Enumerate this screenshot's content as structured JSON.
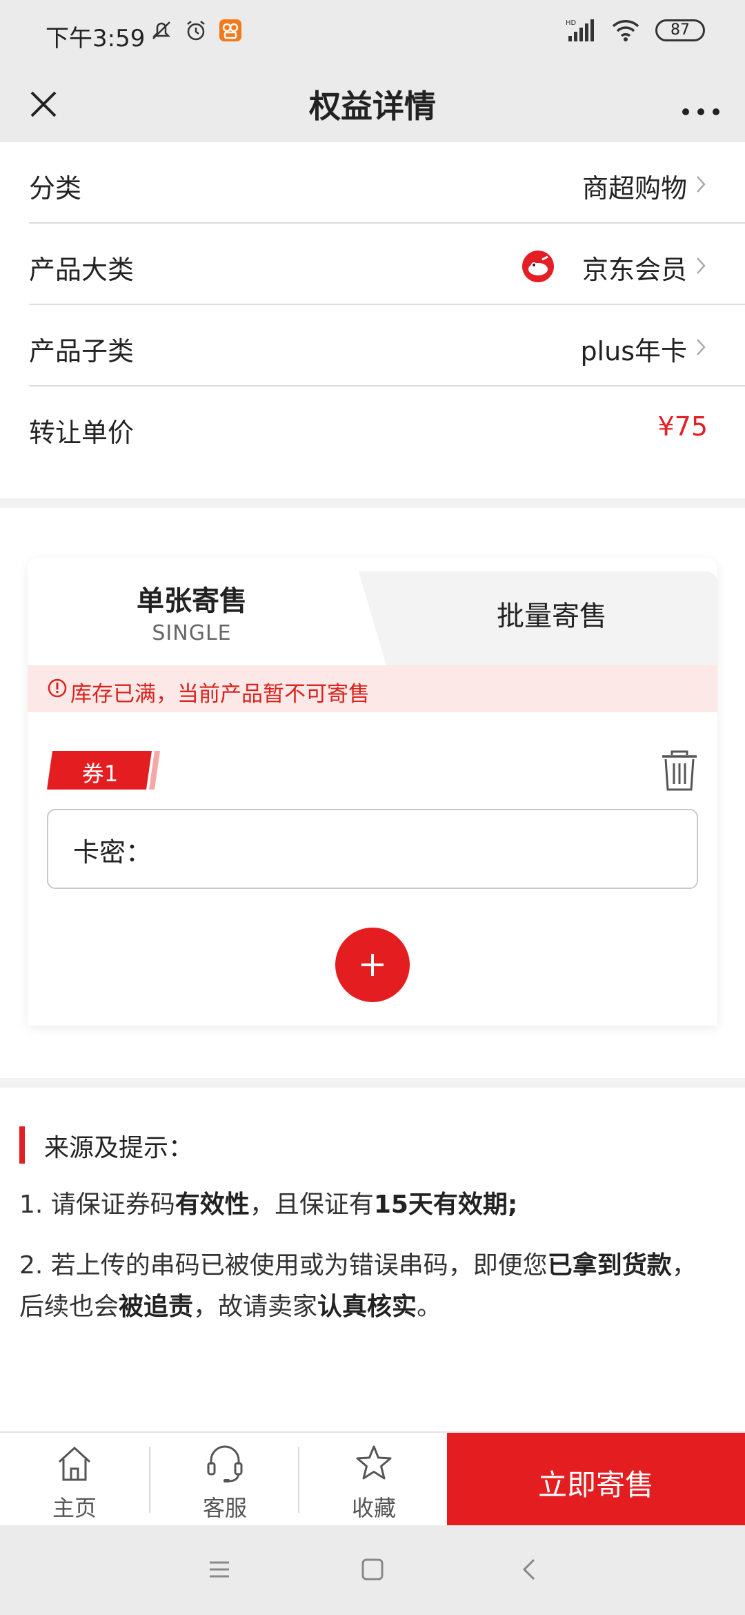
{
  "status_bar": {
    "time": "下午3:59",
    "battery": "87"
  },
  "header": {
    "title": "权益详情"
  },
  "info": {
    "rows": [
      {
        "label": "分类",
        "value": "商超购物"
      },
      {
        "label": "产品大类",
        "value": "京东会员"
      },
      {
        "label": "产品子类",
        "value": "plus年卡"
      },
      {
        "label": "转让单价",
        "value": "¥75"
      }
    ]
  },
  "tabs": {
    "single_title": "单张寄售",
    "single_sub": "SINGLE",
    "batch": "批量寄售"
  },
  "warning": "库存已满，当前产品暂不可寄售",
  "coupon": {
    "tag": "券1",
    "field_label": "卡密："
  },
  "tips": {
    "title": "来源及提示：",
    "tip1_parts": [
      "1. 请保证券码",
      "有效性",
      "，且保证有",
      "15天有效期;"
    ],
    "tip2_parts": [
      "2. 若上传的串码已被使用或为错误串码，即便您",
      "已拿到货款",
      "，后续也会",
      "被追责",
      "，故请卖家",
      "认真核实",
      "。"
    ]
  },
  "bottom_nav": {
    "home": "主页",
    "service": "客服",
    "favorite": "收藏",
    "sell": "立即寄售"
  },
  "colors": {
    "accent": "#e41d20",
    "warning_bg": "#fce8e6"
  }
}
